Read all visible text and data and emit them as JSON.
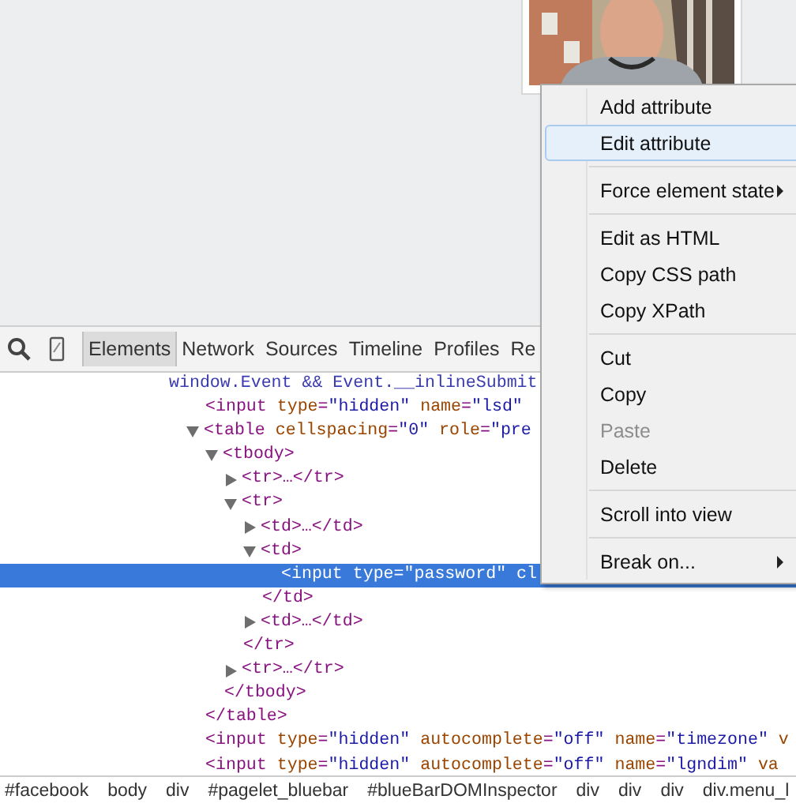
{
  "page": {
    "photo": {
      "kind": "picture"
    }
  },
  "toolbar": {
    "tabs": [
      {
        "label": "Elements",
        "selected": true
      },
      {
        "label": "Network",
        "selected": false
      },
      {
        "label": "Sources",
        "selected": false
      },
      {
        "label": "Timeline",
        "selected": false
      },
      {
        "label": "Profiles",
        "selected": false
      },
      {
        "label": "Re",
        "selected": false
      }
    ]
  },
  "dom_tree": [
    {
      "kind": "leaf",
      "selected": false,
      "tokens": [
        {
          "kind": "text",
          "text": "window.Event && Event.__inlineSubmit"
        }
      ],
      "children": [
        {
          "kind": "leaf",
          "selected": false,
          "tokens": [
            {
              "kind": "tag",
              "text": "<input "
            },
            {
              "kind": "attr",
              "text": "type"
            },
            {
              "kind": "tag",
              "text": "="
            },
            {
              "kind": "value",
              "text": "\"hidden\""
            },
            {
              "kind": "attr",
              "text": " name"
            },
            {
              "kind": "tag",
              "text": "="
            },
            {
              "kind": "value",
              "text": "\"lsd\""
            }
          ]
        },
        {
          "kind": "toggle",
          "expanded": true,
          "selected": false,
          "tokens": [
            {
              "kind": "tag",
              "text": "<table "
            },
            {
              "kind": "attr",
              "text": "cellspacing"
            },
            {
              "kind": "tag",
              "text": "="
            },
            {
              "kind": "value",
              "text": "\"0\""
            },
            {
              "kind": "attr",
              "text": " role"
            },
            {
              "kind": "tag",
              "text": "="
            },
            {
              "kind": "value",
              "text": "\"pre"
            }
          ],
          "close": "</table>",
          "children": [
            {
              "kind": "toggle",
              "expanded": true,
              "selected": false,
              "tokens": [
                {
                  "kind": "tag",
                  "text": "<tbody>"
                }
              ],
              "close": "</tbody>",
              "children": [
                {
                  "kind": "toggle",
                  "expanded": false,
                  "selected": false,
                  "tokens": [
                    {
                      "kind": "tag",
                      "text": "<tr>…</tr>"
                    }
                  ]
                },
                {
                  "kind": "toggle",
                  "expanded": true,
                  "selected": false,
                  "tokens": [
                    {
                      "kind": "tag",
                      "text": "<tr>"
                    }
                  ],
                  "close": "</tr>",
                  "children": [
                    {
                      "kind": "toggle",
                      "expanded": false,
                      "selected": false,
                      "tokens": [
                        {
                          "kind": "tag",
                          "text": "<td>…</td>"
                        }
                      ]
                    },
                    {
                      "kind": "toggle",
                      "expanded": true,
                      "selected": false,
                      "tokens": [
                        {
                          "kind": "tag",
                          "text": "<td>"
                        }
                      ],
                      "close": "</td>",
                      "children": [
                        {
                          "kind": "leaf",
                          "selected": true,
                          "tokens": [
                            {
                              "text": "<input type=\"password\" cl"
                            }
                          ]
                        }
                      ]
                    },
                    {
                      "kind": "toggle",
                      "expanded": false,
                      "selected": false,
                      "tokens": [
                        {
                          "kind": "tag",
                          "text": "<td>…</td>"
                        }
                      ]
                    }
                  ]
                },
                {
                  "kind": "toggle",
                  "expanded": false,
                  "selected": false,
                  "tokens": [
                    {
                      "kind": "tag",
                      "text": "<tr>…</tr>"
                    }
                  ]
                }
              ]
            }
          ]
        },
        {
          "kind": "leaf",
          "selected": false,
          "tokens": [
            {
              "kind": "tag",
              "text": "<input "
            },
            {
              "kind": "attr",
              "text": "type"
            },
            {
              "kind": "tag",
              "text": "="
            },
            {
              "kind": "value",
              "text": "\"hidden\""
            },
            {
              "kind": "attr",
              "text": " autocomplete"
            },
            {
              "kind": "tag",
              "text": "="
            },
            {
              "kind": "value",
              "text": "\"off\""
            },
            {
              "kind": "attr",
              "text": " name"
            },
            {
              "kind": "tag",
              "text": "="
            },
            {
              "kind": "value",
              "text": "\"timezone\""
            },
            {
              "kind": "attr",
              "text": " v"
            }
          ]
        },
        {
          "kind": "leaf",
          "selected": false,
          "tokens": [
            {
              "kind": "tag",
              "text": "<input "
            },
            {
              "kind": "attr",
              "text": "type"
            },
            {
              "kind": "tag",
              "text": "="
            },
            {
              "kind": "value",
              "text": "\"hidden\""
            },
            {
              "kind": "attr",
              "text": " autocomplete"
            },
            {
              "kind": "tag",
              "text": "="
            },
            {
              "kind": "value",
              "text": "\"off\""
            },
            {
              "kind": "attr",
              "text": " name"
            },
            {
              "kind": "tag",
              "text": "="
            },
            {
              "kind": "value",
              "text": "\"lgndim\""
            },
            {
              "kind": "attr",
              "text": " va"
            }
          ]
        }
      ]
    }
  ],
  "breadcrumbs": [
    "#facebook",
    "body",
    "div",
    "#pagelet_bluebar",
    "#blueBarDOMInspector",
    "div",
    "div",
    "div",
    "div.menu_l"
  ],
  "context_menu": [
    [
      {
        "label": "Add attribute",
        "selected": false,
        "disabled": false,
        "submenu": false
      },
      {
        "label": "Edit attribute",
        "selected": true,
        "disabled": false,
        "submenu": false
      }
    ],
    [
      {
        "label": "Force element state",
        "selected": false,
        "disabled": false,
        "submenu": true
      }
    ],
    [
      {
        "label": "Edit as HTML",
        "selected": false,
        "disabled": false,
        "submenu": false
      },
      {
        "label": "Copy CSS path",
        "selected": false,
        "disabled": false,
        "submenu": false
      },
      {
        "label": "Copy XPath",
        "selected": false,
        "disabled": false,
        "submenu": false
      }
    ],
    [
      {
        "label": "Cut",
        "selected": false,
        "disabled": false,
        "submenu": false
      },
      {
        "label": "Copy",
        "selected": false,
        "disabled": false,
        "submenu": false
      },
      {
        "label": "Paste",
        "selected": false,
        "disabled": true,
        "submenu": false
      },
      {
        "label": "Delete",
        "selected": false,
        "disabled": false,
        "submenu": false
      }
    ],
    [
      {
        "label": "Scroll into view",
        "selected": false,
        "disabled": false,
        "submenu": false
      }
    ],
    [
      {
        "label": "Break on...",
        "selected": false,
        "disabled": false,
        "submenu": true
      }
    ]
  ]
}
